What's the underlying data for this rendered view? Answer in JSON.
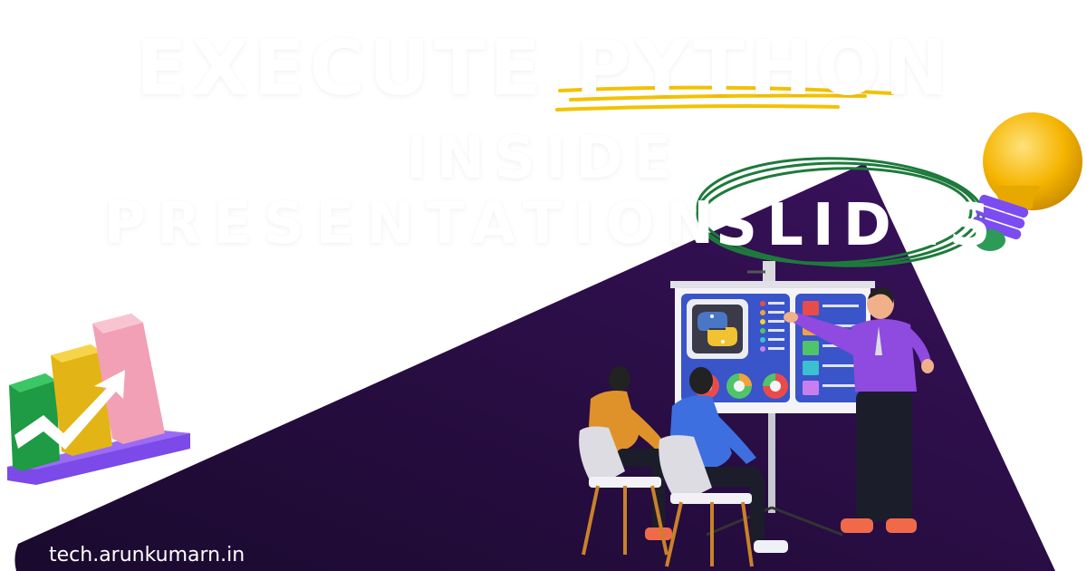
{
  "headline": {
    "line1": "EXECUTE PYTHON",
    "line2": "INSIDE",
    "line3": "PRESENTATION",
    "highlight": "SLIDES"
  },
  "footer": {
    "url": "tech.arunkumarn.in"
  },
  "colors": {
    "background": "#ffffff",
    "panel": "#2a0d44",
    "underline": "#f2c200",
    "circle": "#1e7a3c"
  },
  "icons": [
    "bar-chart-icon",
    "lightbulb-icon",
    "python-logo-icon",
    "presenter-illustration"
  ]
}
